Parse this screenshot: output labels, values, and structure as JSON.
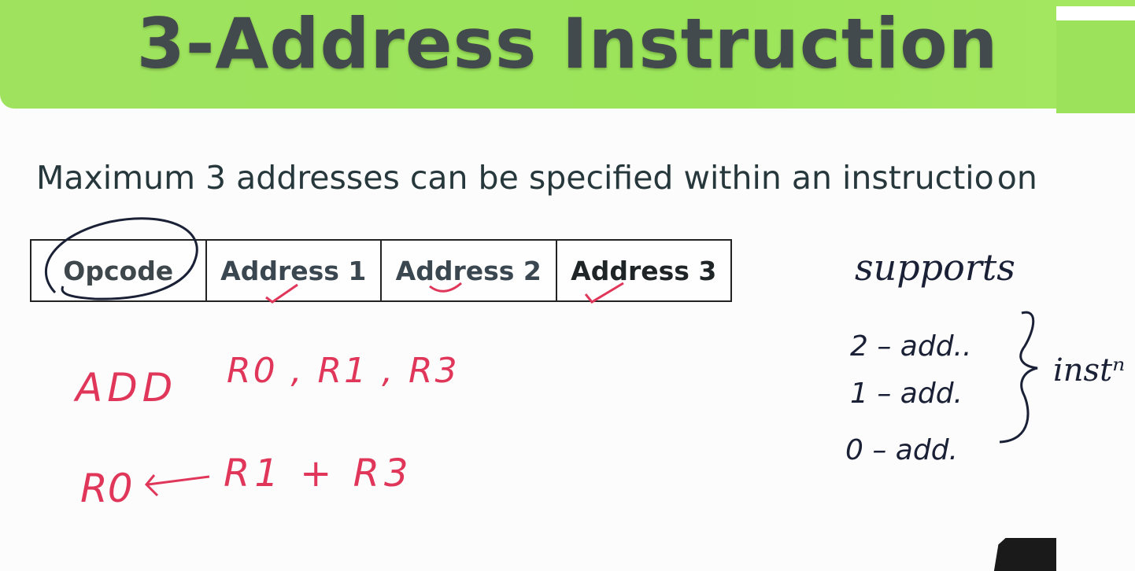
{
  "slide": {
    "title": "3-Address Instruction",
    "subtitle_main": "Maximum 3 addresses can be specified within an instructio",
    "subtitle_tail": "on"
  },
  "instruction_format": {
    "fields": [
      "Opcode",
      "Address 1",
      "Address 2",
      "Address 3"
    ]
  },
  "handwriting": {
    "example_instruction": "ADD  R0, R1, R3",
    "example_semantics": "R0 ← R1 + R3",
    "side_note": {
      "heading": "supports",
      "items": [
        "2 - add.",
        "1 - add.",
        "0 - add."
      ],
      "group_label": "instⁿ"
    }
  },
  "colors": {
    "title_band": "#9fe25e",
    "ink_red": "#e0365a",
    "ink_dark": "#1a2035"
  }
}
